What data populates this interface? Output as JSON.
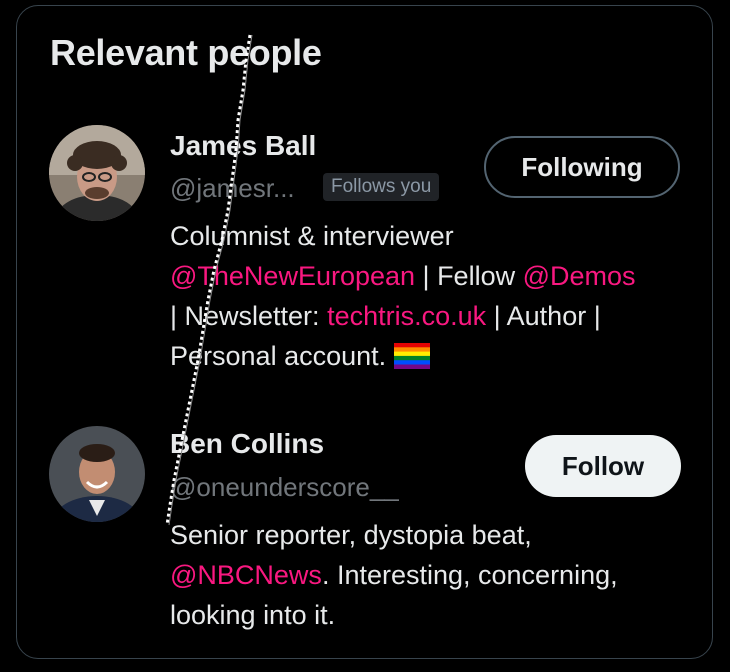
{
  "panel": {
    "title": "Relevant people"
  },
  "people": [
    {
      "name": "James Ball",
      "handle": "@jamesr...",
      "badge": "Follows you",
      "button": "Following",
      "bio": {
        "l1": "Columnist & interviewer",
        "l2a": "@TheNewEuropean",
        "l2b": " | Fellow ",
        "l2c": "@Demos",
        "l3a": "| Newsletter: ",
        "l3b": "techtris.co.uk",
        "l3c": " | Author |",
        "l4": "Personal account. "
      },
      "emoji": "rainbow-flag"
    },
    {
      "name": "Ben Collins",
      "handle": "@oneunderscore__",
      "button": "Follow",
      "bio": {
        "l1": "Senior reporter, dystopia beat,",
        "l2a": "@NBCNews",
        "l2b": ". Interesting, concerning,",
        "l3": "looking into it."
      }
    }
  ],
  "colors": {
    "background": "#000000",
    "text": "#e7e9ea",
    "muted": "#71767b",
    "link": "#f91880",
    "follow_bg": "#eff3f4"
  }
}
